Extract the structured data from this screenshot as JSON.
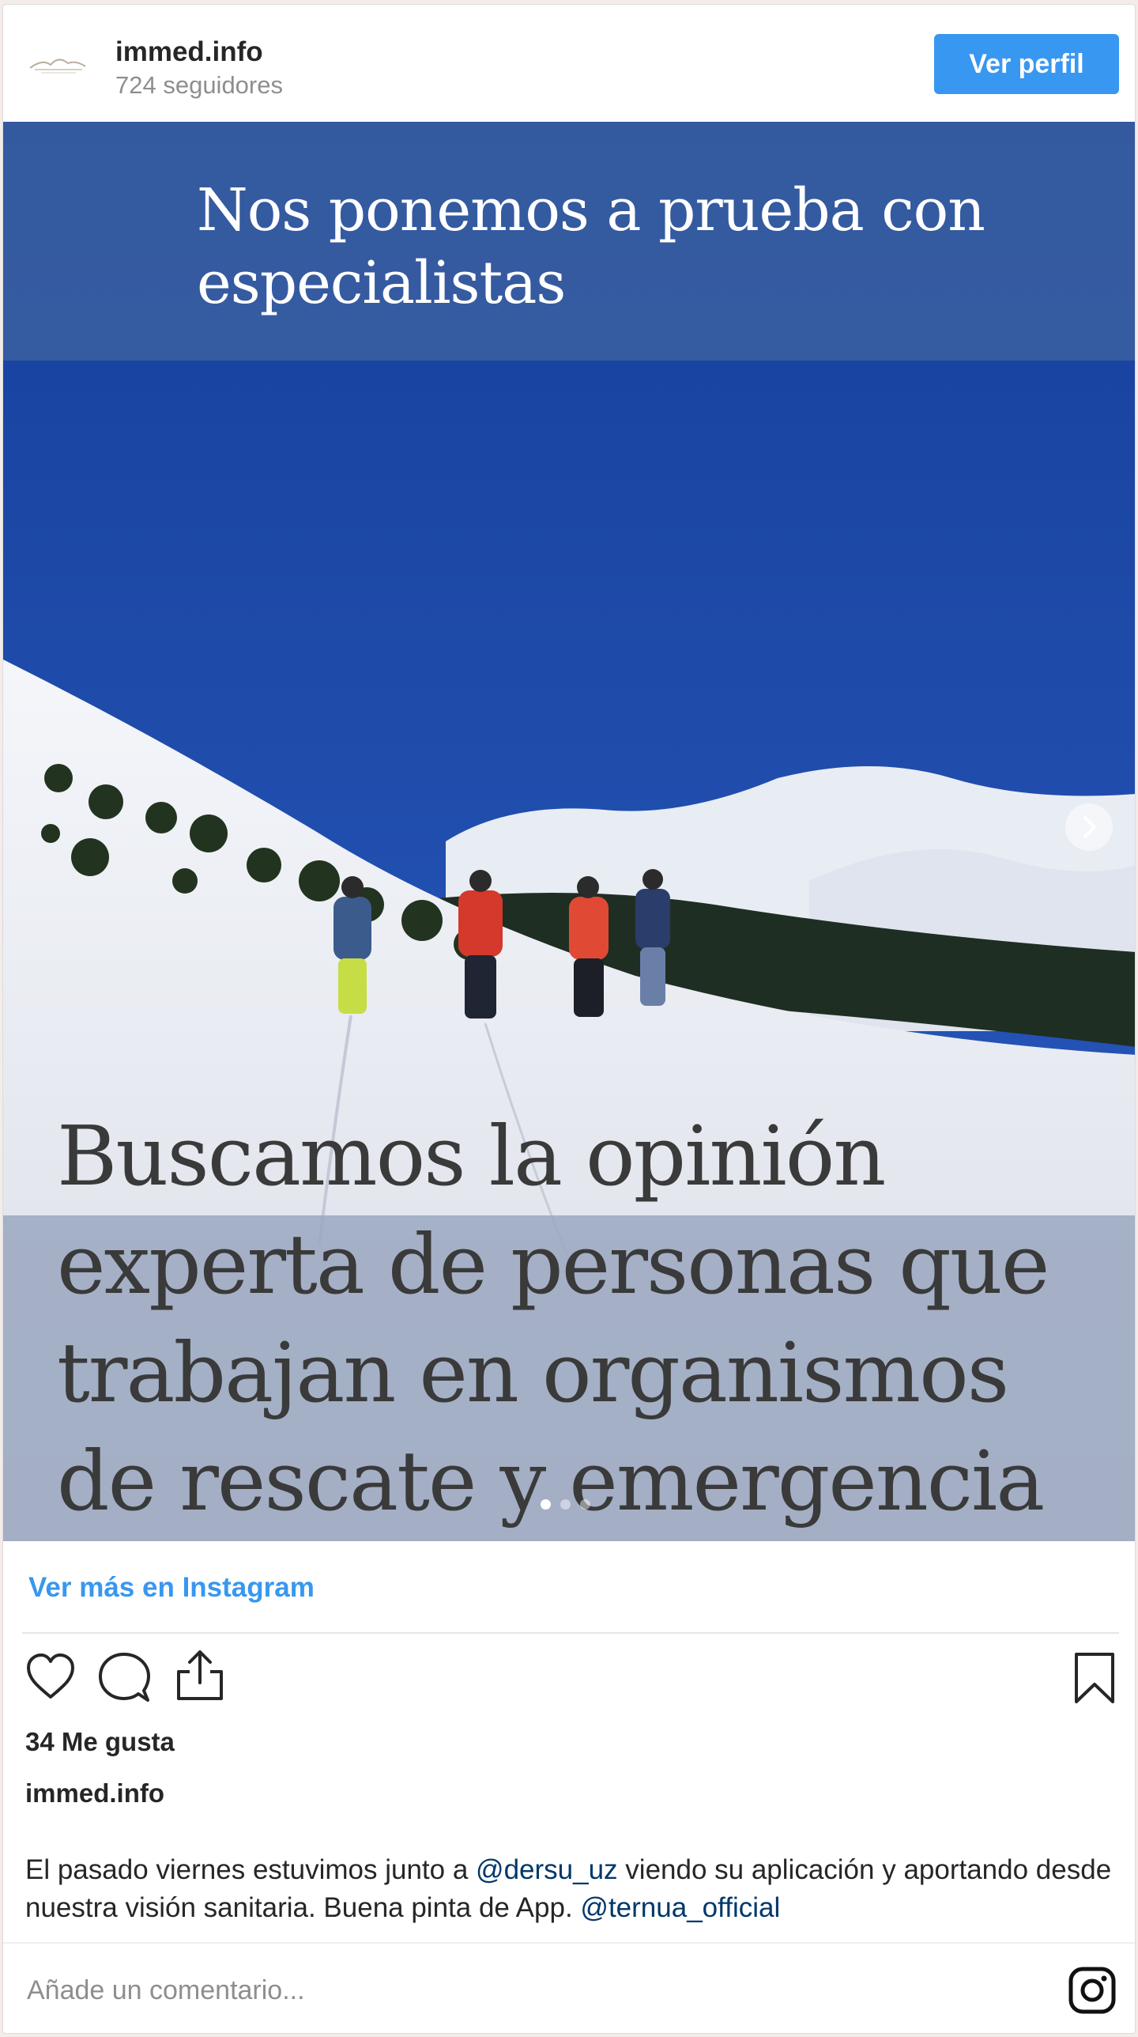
{
  "header": {
    "username": "immed.info",
    "followers": "724 seguidores",
    "profile_button": "Ver perfil"
  },
  "media": {
    "top_text": "Nos ponemos a prueba con especialistas",
    "bottom_text": "Buscamos la opinión experta de personas que trabajan en organismos de rescate y emergencia",
    "slide_count": 3,
    "active_slide": 1
  },
  "more_link": "Ver más en Instagram",
  "actions": {
    "like_icon": "heart-icon",
    "comment_icon": "comment-icon",
    "share_icon": "share-icon",
    "save_icon": "bookmark-icon"
  },
  "likes": "34 Me gusta",
  "author": "immed.info",
  "caption": {
    "part1": "El pasado viernes estuvimos junto a ",
    "mention1": "@dersu_uz",
    "part2": " viendo su aplicación y aportando desde nuestra visión sanitaria. Buena pinta de App. ",
    "mention2": "@ternua_official"
  },
  "comment": {
    "placeholder": "Añade un comentario..."
  },
  "colors": {
    "accent": "#3897f0",
    "mention": "#00376b",
    "sky": "#1c49a6"
  }
}
